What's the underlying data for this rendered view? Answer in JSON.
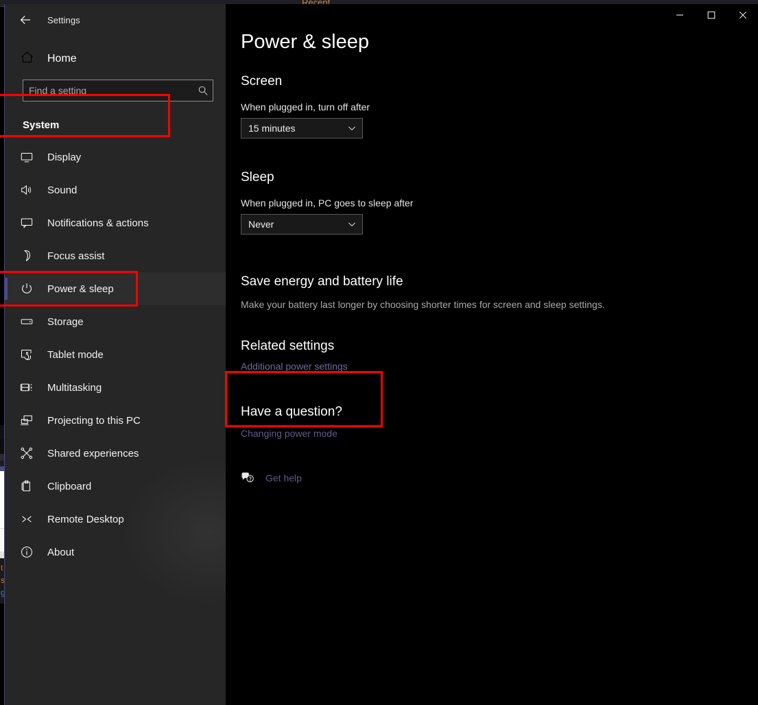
{
  "background": {
    "recent_window_label": "Recent",
    "sliver_lines": [
      "t",
      "s",
      "g"
    ]
  },
  "window": {
    "title": "Settings",
    "back_icon": "back-arrow-icon",
    "caption": {
      "minimize_icon": "minimize-icon",
      "maximize_icon": "maximize-icon",
      "close_icon": "close-icon"
    }
  },
  "sidebar": {
    "home": {
      "label": "Home",
      "icon": "home-icon"
    },
    "search": {
      "placeholder": "Find a setting",
      "value": "",
      "icon": "search-icon"
    },
    "category": "System",
    "items": [
      {
        "label": "Display",
        "icon": "monitor-icon",
        "selected": false
      },
      {
        "label": "Sound",
        "icon": "speaker-icon",
        "selected": false
      },
      {
        "label": "Notifications & actions",
        "icon": "chat-bubble-icon",
        "selected": false
      },
      {
        "label": "Focus assist",
        "icon": "moon-icon",
        "selected": false
      },
      {
        "label": "Power & sleep",
        "icon": "power-icon",
        "selected": true
      },
      {
        "label": "Storage",
        "icon": "drive-icon",
        "selected": false
      },
      {
        "label": "Tablet mode",
        "icon": "tablet-hand-icon",
        "selected": false
      },
      {
        "label": "Multitasking",
        "icon": "multitasking-icon",
        "selected": false
      },
      {
        "label": "Projecting to this PC",
        "icon": "projecting-icon",
        "selected": false
      },
      {
        "label": "Shared experiences",
        "icon": "share-nodes-icon",
        "selected": false
      },
      {
        "label": "Clipboard",
        "icon": "clipboard-icon",
        "selected": false
      },
      {
        "label": "Remote Desktop",
        "icon": "remote-desktop-icon",
        "selected": false
      },
      {
        "label": "About",
        "icon": "info-icon",
        "selected": false
      }
    ]
  },
  "main": {
    "page_title": "Power & sleep",
    "screen": {
      "heading": "Screen",
      "field_label": "When plugged in, turn off after",
      "dropdown_value": "15 minutes"
    },
    "sleep": {
      "heading": "Sleep",
      "field_label": "When plugged in, PC goes to sleep after",
      "dropdown_value": "Never"
    },
    "save_energy": {
      "heading": "Save energy and battery life",
      "description": "Make your battery last longer by choosing shorter times for screen and sleep settings."
    },
    "related_settings": {
      "heading": "Related settings",
      "link": "Additional power settings"
    },
    "have_a_question": {
      "heading": "Have a question?",
      "link": "Changing power mode"
    },
    "get_help": {
      "label": "Get help",
      "icon": "help-bubble-icon"
    }
  },
  "annotations": {
    "color": "#ff0000",
    "boxes": [
      "System",
      "Power & sleep",
      "Related settings"
    ]
  },
  "colors": {
    "sidebar_bg": "#262626",
    "content_bg": "#000000",
    "accent_bar": "#4a4a8f",
    "link": "#5c5c8c",
    "annotation": "#ff0000"
  }
}
